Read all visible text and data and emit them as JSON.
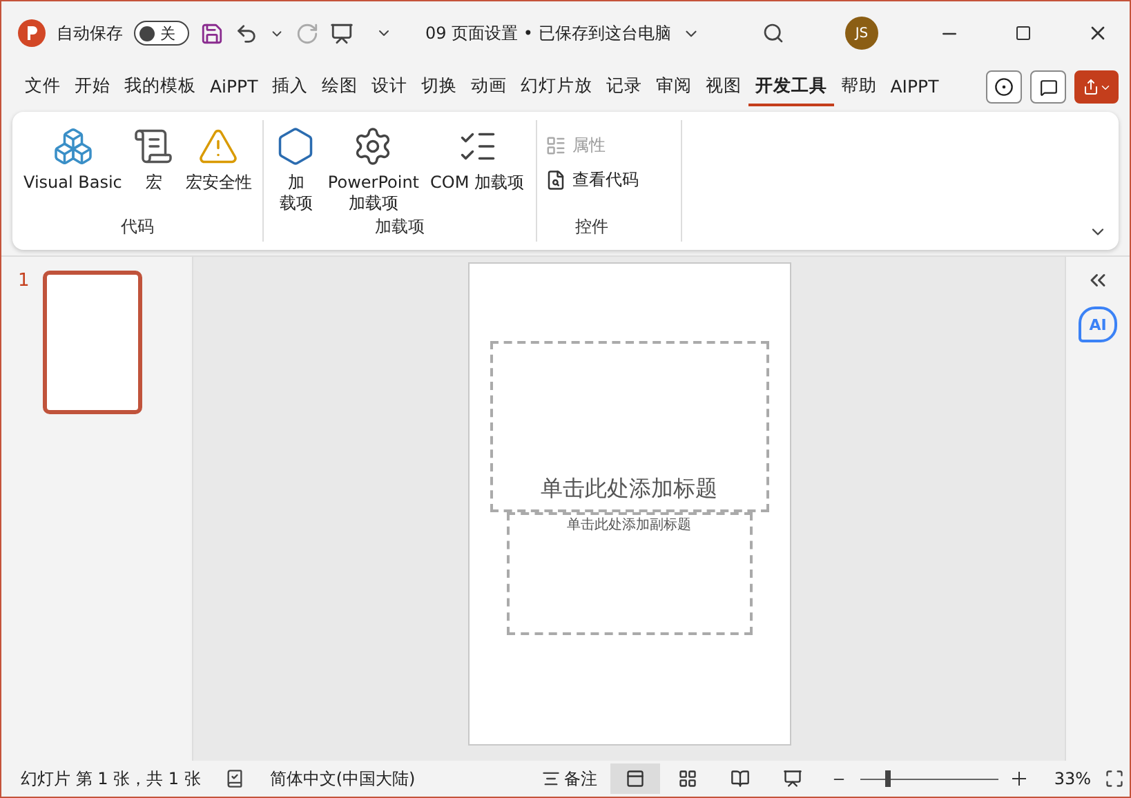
{
  "titlebar": {
    "autosave_label": "自动保存",
    "autosave": {
      "on": false,
      "label": "关"
    },
    "doc_title": "09 页面设置 • 已保存到这台电脑",
    "avatar": "JS"
  },
  "tabs": [
    {
      "label": "文件",
      "selected": false
    },
    {
      "label": "开始",
      "selected": false
    },
    {
      "label": "我的模板",
      "selected": false
    },
    {
      "label": "AiPPT",
      "selected": false
    },
    {
      "label": "插入",
      "selected": false
    },
    {
      "label": "绘图",
      "selected": false
    },
    {
      "label": "设计",
      "selected": false
    },
    {
      "label": "切换",
      "selected": false
    },
    {
      "label": "动画",
      "selected": false
    },
    {
      "label": "幻灯片放",
      "selected": false
    },
    {
      "label": "记录",
      "selected": false
    },
    {
      "label": "审阅",
      "selected": false
    },
    {
      "label": "视图",
      "selected": false
    },
    {
      "label": "开发工具",
      "selected": true
    },
    {
      "label": "帮助",
      "selected": false
    },
    {
      "label": "AIPPT",
      "selected": false
    }
  ],
  "ribbon_groups": [
    {
      "name": "代码",
      "items": [
        {
          "kind": "large",
          "lines": [
            "Visual Basic"
          ],
          "disabled": false
        },
        {
          "kind": "large",
          "lines": [
            "宏"
          ],
          "disabled": false
        },
        {
          "kind": "large",
          "lines": [
            "宏安全性"
          ],
          "disabled": false
        }
      ]
    },
    {
      "name": "加载项",
      "items": [
        {
          "kind": "large",
          "lines": [
            "加",
            "载项"
          ],
          "disabled": false
        },
        {
          "kind": "large",
          "lines": [
            "PowerPoint",
            "加载项"
          ],
          "disabled": false
        },
        {
          "kind": "large",
          "lines": [
            "COM 加载项"
          ],
          "disabled": false
        }
      ]
    },
    {
      "name": "控件",
      "items": [
        {
          "kind": "small",
          "lines": [
            "属性"
          ],
          "disabled": true
        },
        {
          "kind": "small",
          "lines": [
            "查看代码"
          ],
          "disabled": false
        }
      ]
    }
  ],
  "slides_panel": [
    {
      "number": "1",
      "selected": true
    }
  ],
  "slide": {
    "title_placeholder": "单击此处添加标题",
    "subtitle_placeholder": "单击此处添加副标题"
  },
  "side_pane": {
    "ai_badge": "AI"
  },
  "status_bar": {
    "slide_info": "幻灯片 第 1 张，共 1 张",
    "language": "简体中文(中国大陆)",
    "notes": "备注",
    "views": [
      {
        "selected": true
      },
      {
        "selected": false
      },
      {
        "selected": false
      },
      {
        "selected": false
      }
    ],
    "zoom": {
      "level": 0.18,
      "reading": "33%"
    }
  }
}
